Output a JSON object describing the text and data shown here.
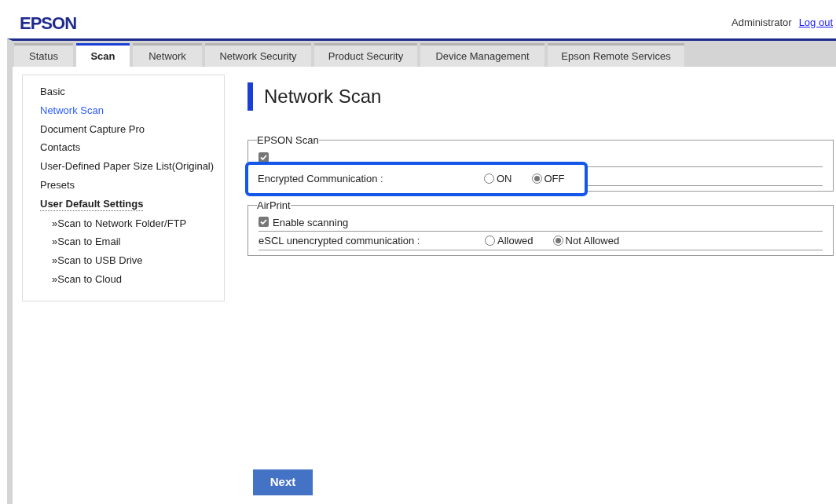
{
  "header": {
    "logo": "EPSON",
    "user": "Administrator",
    "logout": "Log out"
  },
  "tabs": [
    {
      "label": "Status",
      "selected": false
    },
    {
      "label": "Scan",
      "selected": true
    },
    {
      "label": "Network",
      "selected": false
    },
    {
      "label": "Network Security",
      "selected": false
    },
    {
      "label": "Product Security",
      "selected": false
    },
    {
      "label": "Device Management",
      "selected": false
    },
    {
      "label": "Epson Remote Services",
      "selected": false
    }
  ],
  "sidebar": {
    "items": [
      {
        "label": "Basic",
        "kind": "link",
        "selected": false
      },
      {
        "label": "Network Scan",
        "kind": "link",
        "selected": true
      },
      {
        "label": "Document Capture Pro",
        "kind": "link",
        "selected": false
      },
      {
        "label": "Contacts",
        "kind": "link",
        "selected": false
      },
      {
        "label": "User-Defined Paper Size List(Original)",
        "kind": "link",
        "selected": false
      },
      {
        "label": "Presets",
        "kind": "link",
        "selected": false
      },
      {
        "label": "User Default Settings",
        "kind": "heading",
        "selected": false
      },
      {
        "label": "»Scan to Network Folder/FTP",
        "kind": "sublink",
        "selected": false
      },
      {
        "label": "»Scan to Email",
        "kind": "sublink",
        "selected": false
      },
      {
        "label": "»Scan to USB Drive",
        "kind": "sublink",
        "selected": false
      },
      {
        "label": "»Scan to Cloud",
        "kind": "sublink",
        "selected": false
      }
    ]
  },
  "page_title": "Network Scan",
  "sections": [
    {
      "legend": "EPSON Scan",
      "rows": [
        {
          "kind": "checkbox",
          "checked": true
        },
        {
          "kind": "radio",
          "label": "Encrypted Communication :",
          "highlighted": true,
          "options": [
            {
              "label": "ON",
              "selected": false
            },
            {
              "label": "OFF",
              "selected": true
            }
          ]
        }
      ]
    },
    {
      "legend": "AirPrint",
      "rows": [
        {
          "kind": "checkbox",
          "label": "Enable scanning",
          "checked": true
        },
        {
          "kind": "radio",
          "label": "eSCL unencrypted communication :",
          "highlighted": false,
          "options": [
            {
              "label": "Allowed",
              "selected": false
            },
            {
              "label": "Not Allowed",
              "selected": true
            }
          ]
        }
      ]
    }
  ],
  "next_button": "Next"
}
